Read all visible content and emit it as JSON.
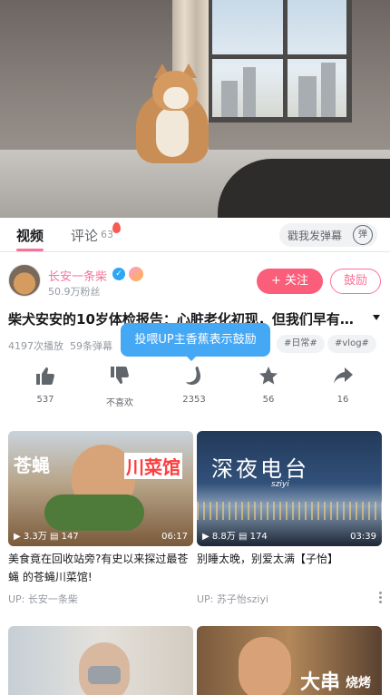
{
  "tabs": {
    "video_label": "视频",
    "comments_label": "评论",
    "comments_count": "63",
    "danmaku_placeholder": "戳我发弹幕",
    "danmaku_toggle": "弹"
  },
  "uploader": {
    "name": "长安一条柴",
    "fans": "50.9万粉丝",
    "follow_label": "+ 关注",
    "charge_label": "鼓励"
  },
  "video": {
    "title": "柴犬安安的10岁体检报告：心脏老化初现，但我们早有…",
    "plays": "4197次播放",
    "danmaku_count": "59条弹幕",
    "tags": [
      "#日常#",
      "#vlog#"
    ],
    "tooltip": "投喂UP主香蕉表示鼓励"
  },
  "actions": [
    {
      "icon": "thumbs-up-icon",
      "label": "537"
    },
    {
      "icon": "thumbs-down-icon",
      "label": "不喜欢"
    },
    {
      "icon": "banana-icon",
      "label": "2353"
    },
    {
      "icon": "star-icon",
      "label": "56"
    },
    {
      "icon": "share-icon",
      "label": "16"
    }
  ],
  "recommendations": [
    {
      "thumb_text_left": "苍蝇",
      "thumb_text_right": "川菜馆",
      "plays": "3.3万",
      "danmaku": "147",
      "duration": "06:17",
      "title": "美食竟在回收站旁?有史以来探过最苍蝇 的苍蝇川菜馆!",
      "up": "UP: 长安一条柴"
    },
    {
      "thumb_text": "深夜电台",
      "thumb_sub": "sziyi",
      "plays": "8.8万",
      "danmaku": "174",
      "duration": "03:39",
      "title": "别睡太晚，别爱太满【子怡】",
      "up": "UP: 苏子怡sziyi"
    },
    {
      "thumb_text": ""
    },
    {
      "thumb_text": "大串",
      "thumb_text_small": "烧烤"
    }
  ],
  "colors": {
    "accent": "#fb7299",
    "follow": "#fb5e7a",
    "tooltip": "#45a8f5",
    "text": "#18191c",
    "muted": "#9499a0"
  }
}
